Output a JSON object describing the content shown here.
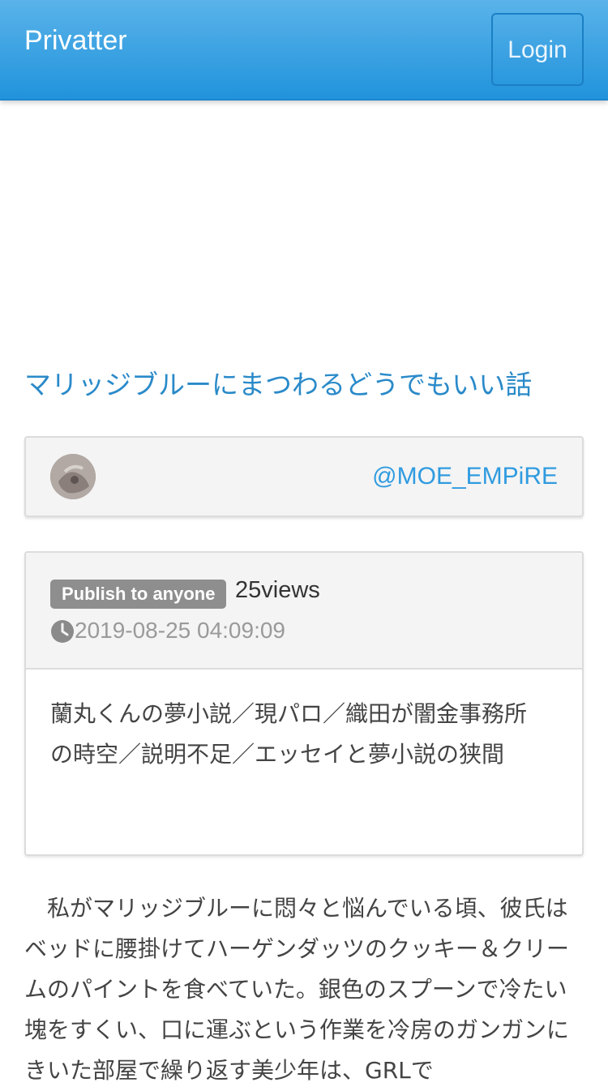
{
  "navbar": {
    "brand": "Privatter",
    "login_label": "Login"
  },
  "post": {
    "title": "マリッジブルーにまつわるどうでもいい話",
    "author_handle": "@MOE_EMPiRE",
    "visibility_badge": "Publish to anyone",
    "views": "25views",
    "timestamp": "2019-08-25 04:09:09",
    "caption": "蘭丸くんの夢小説／現パロ／織田が闇金事務所の時空／説明不足／エッセイと夢小説の狭間",
    "body": "　私がマリッジブルーに悶々と悩んでいる頃、彼氏はベッドに腰掛けてハーゲンダッツのクッキー＆クリームのパイントを食べていた。銀色のスプーンで冷たい塊をすくい、口に運ぶという作業を冷房のガンガンにきいた部屋で繰り返す美少年は、GRLで"
  },
  "icons": {
    "clock": "clock-icon",
    "avatar": "avatar"
  },
  "colors": {
    "navbar_top": "#5ab3e9",
    "navbar_bottom": "#2193dc",
    "link": "#2a8ac9",
    "badge": "#8e8e8e"
  }
}
